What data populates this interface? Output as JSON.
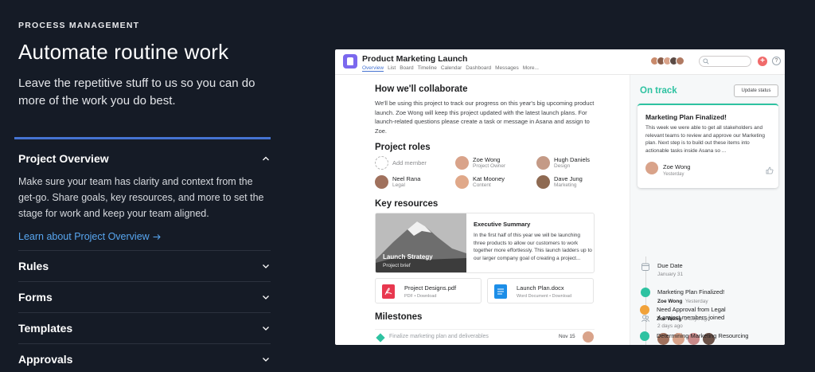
{
  "section_label": "PROCESS MANAGEMENT",
  "headline": "Automate routine work",
  "subheadline": "Leave the repetitive stuff to us so you can do more of the work you do best.",
  "accordion": {
    "open": {
      "title": "Project Overview",
      "body": "Make sure your team has clarity and context from the get-go. Share goals, key resources, and more to set the stage for work and keep your team aligned.",
      "link": "Learn about Project Overview"
    },
    "items": [
      "Rules",
      "Forms",
      "Templates",
      "Approvals"
    ]
  },
  "screenshot": {
    "project_title": "Product Marketing Launch",
    "tabs": [
      "Overview",
      "List",
      "Board",
      "Timeline",
      "Calendar",
      "Dashboard",
      "Messages",
      "More..."
    ],
    "collab_heading": "How we'll collaborate",
    "collab_text": "We'll be using this project to track our progress on this year's big upcoming product launch. Zoe Wong will keep this project updated with the latest launch plans. For launch-related questions please create a task or message in Asana and assign to Zoe.",
    "roles_heading": "Project roles",
    "add_member": "Add member",
    "roles": [
      {
        "name": "Zoe Wong",
        "role": "Project Owner"
      },
      {
        "name": "Hugh Daniels",
        "role": "Design"
      },
      {
        "name": "Neel Rana",
        "role": "Legal"
      },
      {
        "name": "Kat Mooney",
        "role": "Content"
      },
      {
        "name": "Dave Jung",
        "role": "Marketing"
      }
    ],
    "resources_heading": "Key resources",
    "resource_card": {
      "image_title": "Launch Strategy",
      "image_sub": "Project brief",
      "title": "Executive Summary",
      "text": "In the first half of this year we will be launching three products to allow our customers to work together more effortlessly. This launch ladders up to our larger company goal of creating a project..."
    },
    "files": [
      {
        "name": "Project Designs.pdf",
        "meta": "PDF • Download"
      },
      {
        "name": "Launch Plan.docx",
        "meta": "Word Document • Download"
      }
    ],
    "milestones_heading": "Milestones",
    "milestone": {
      "text": "Finalize marketing plan and deliverables",
      "date": "Nov 15"
    },
    "status": {
      "label": "On track",
      "update_button": "Update status",
      "card_title": "Marketing Plan Finalized!",
      "card_text": "This week we were able to get all stakeholders and relevant teams to review and approve our Marketing plan. Next step is to build out these items into actionable tasks inside Asana so ...",
      "author": "Zoe Wong",
      "when": "Yesterday"
    },
    "timeline": [
      {
        "title": "Due Date",
        "sub": "January 31"
      },
      {
        "title": "Marketing Plan Finalized!",
        "who": "Zoe Wong",
        "when": "Yesterday"
      },
      {
        "title": "4 project members joined",
        "sub": "2 days ago"
      },
      {
        "title": "Need Approval from Legal",
        "who": "Zoe Wong",
        "when": "2 days ago"
      },
      {
        "title": "Determining Marketing Resourcing"
      }
    ],
    "colors": {
      "accent_blue": "#4573d2",
      "on_track_green": "#2ec2a1",
      "orange": "#f1a23a",
      "coral": "#f06a6a"
    }
  }
}
